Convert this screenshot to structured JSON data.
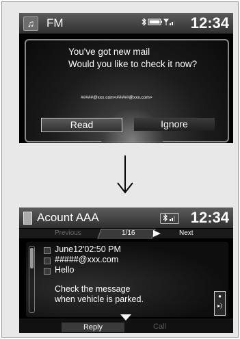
{
  "colors": {
    "screen_bg": "#000000",
    "frame_bg": "#e8e8e8",
    "text": "#ffffff",
    "disabled": "#6a6a6a"
  },
  "screen1": {
    "status_bar": {
      "source_icon": "music-note-icon",
      "source_label": "FM",
      "status_icons": "bluetooth, battery, signal",
      "time": "12:34"
    },
    "dialog": {
      "line1": "You've got new mail",
      "line2": "Would you like to check it now?",
      "address": "#####@xxx.com<#####@xxx.com>",
      "read_label": "Read",
      "ignore_label": "Ignore"
    }
  },
  "arrow": {
    "icon": "down-arrow-icon"
  },
  "screen2": {
    "status_bar": {
      "account_icon": "phone-icon",
      "account_label": "Acount AAA",
      "bt_icons": "bluetooth, signal",
      "time": "12:34"
    },
    "nav": {
      "previous_label": "Previous",
      "page": "1/16",
      "next_label": "Next"
    },
    "mail": {
      "date": "June12'02:50 PM",
      "from": "#####@xxx.com",
      "subject": "Hello",
      "notice_line1": "Check the message",
      "notice_line2": "when vehicle is parked."
    },
    "footer": {
      "reply_label": "Reply",
      "call_label": "Call"
    }
  }
}
